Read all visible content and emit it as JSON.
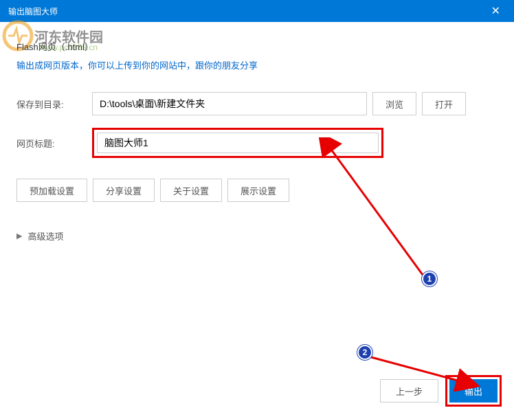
{
  "titlebar": {
    "title": "输出脑图大师"
  },
  "watermark": {
    "text": "河东软件园",
    "url": "www.pc0359.cn"
  },
  "format": {
    "title": "Flash网页（.html）",
    "description": "输出成网页版本，你可以上传到你的网站中，跟你的朋友分享"
  },
  "form": {
    "save_path_label": "保存到目录:",
    "save_path_value": "D:\\tools\\桌面\\新建文件夹",
    "browse_label": "浏览",
    "open_label": "打开",
    "page_title_label": "网页标题:",
    "page_title_value": "脑图大师1"
  },
  "settings_buttons": {
    "preload": "预加载设置",
    "share": "分享设置",
    "about": "关于设置",
    "display": "展示设置"
  },
  "advanced": {
    "label": "高级选项"
  },
  "footer": {
    "prev": "上一步",
    "export": "输出"
  },
  "annotations": {
    "badge1": "1",
    "badge2": "2"
  }
}
